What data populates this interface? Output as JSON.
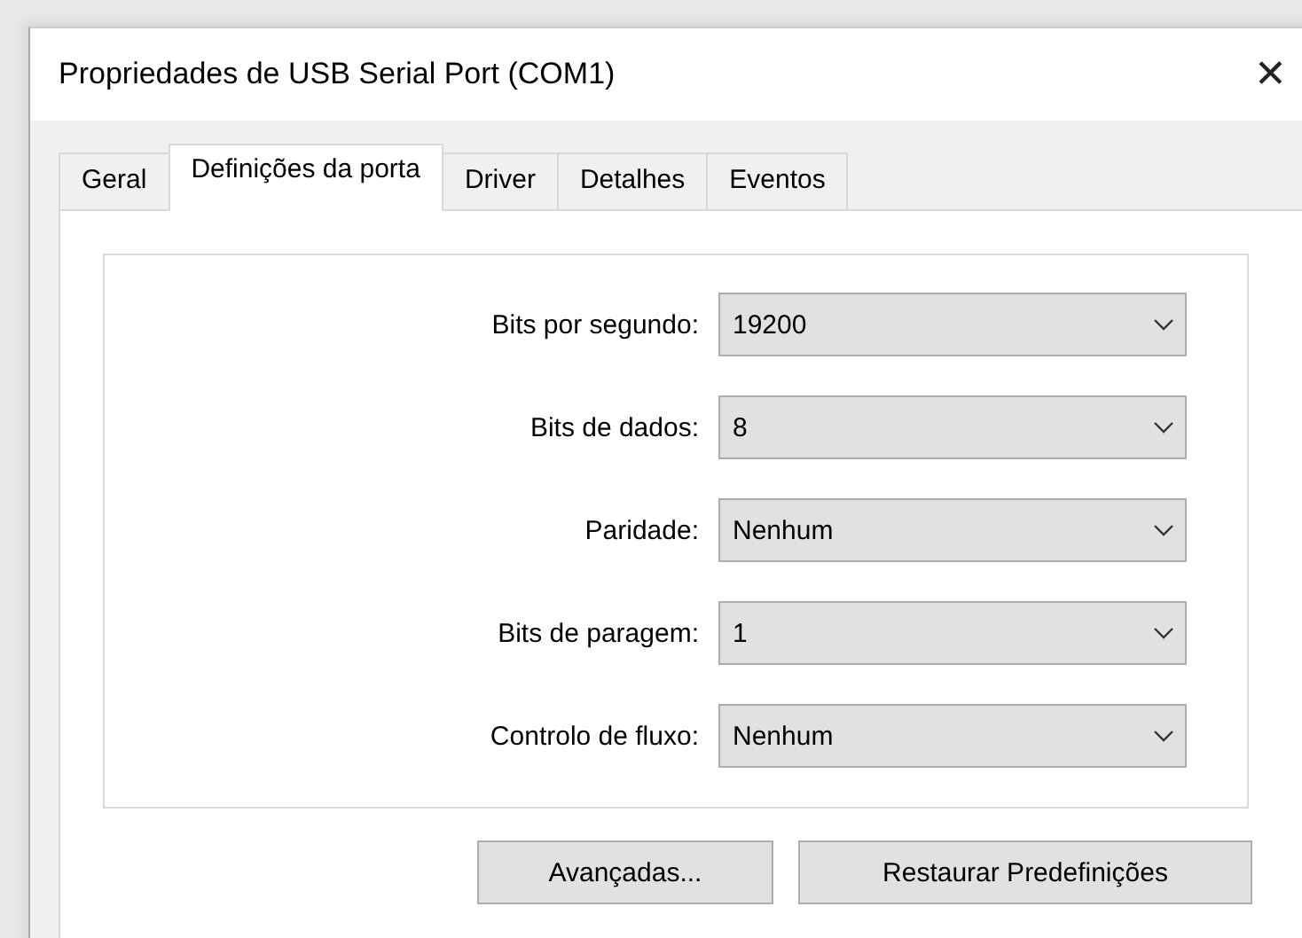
{
  "window": {
    "title": "Propriedades de USB Serial Port (COM1)",
    "close": "✕"
  },
  "tabs": [
    {
      "label": "Geral",
      "selected": false
    },
    {
      "label": "Definições da porta",
      "selected": true
    },
    {
      "label": "Driver",
      "selected": false
    },
    {
      "label": "Detalhes",
      "selected": false
    },
    {
      "label": "Eventos",
      "selected": false
    }
  ],
  "settings": [
    {
      "label": "Bits por segundo:",
      "value": "19200"
    },
    {
      "label": "Bits de dados:",
      "value": "8"
    },
    {
      "label": "Paridade:",
      "value": "Nenhum"
    },
    {
      "label": "Bits de paragem:",
      "value": "1"
    },
    {
      "label": "Controlo de fluxo:",
      "value": "Nenhum"
    }
  ],
  "buttons": [
    "Avançadas...",
    "Restaurar Predefinições"
  ]
}
